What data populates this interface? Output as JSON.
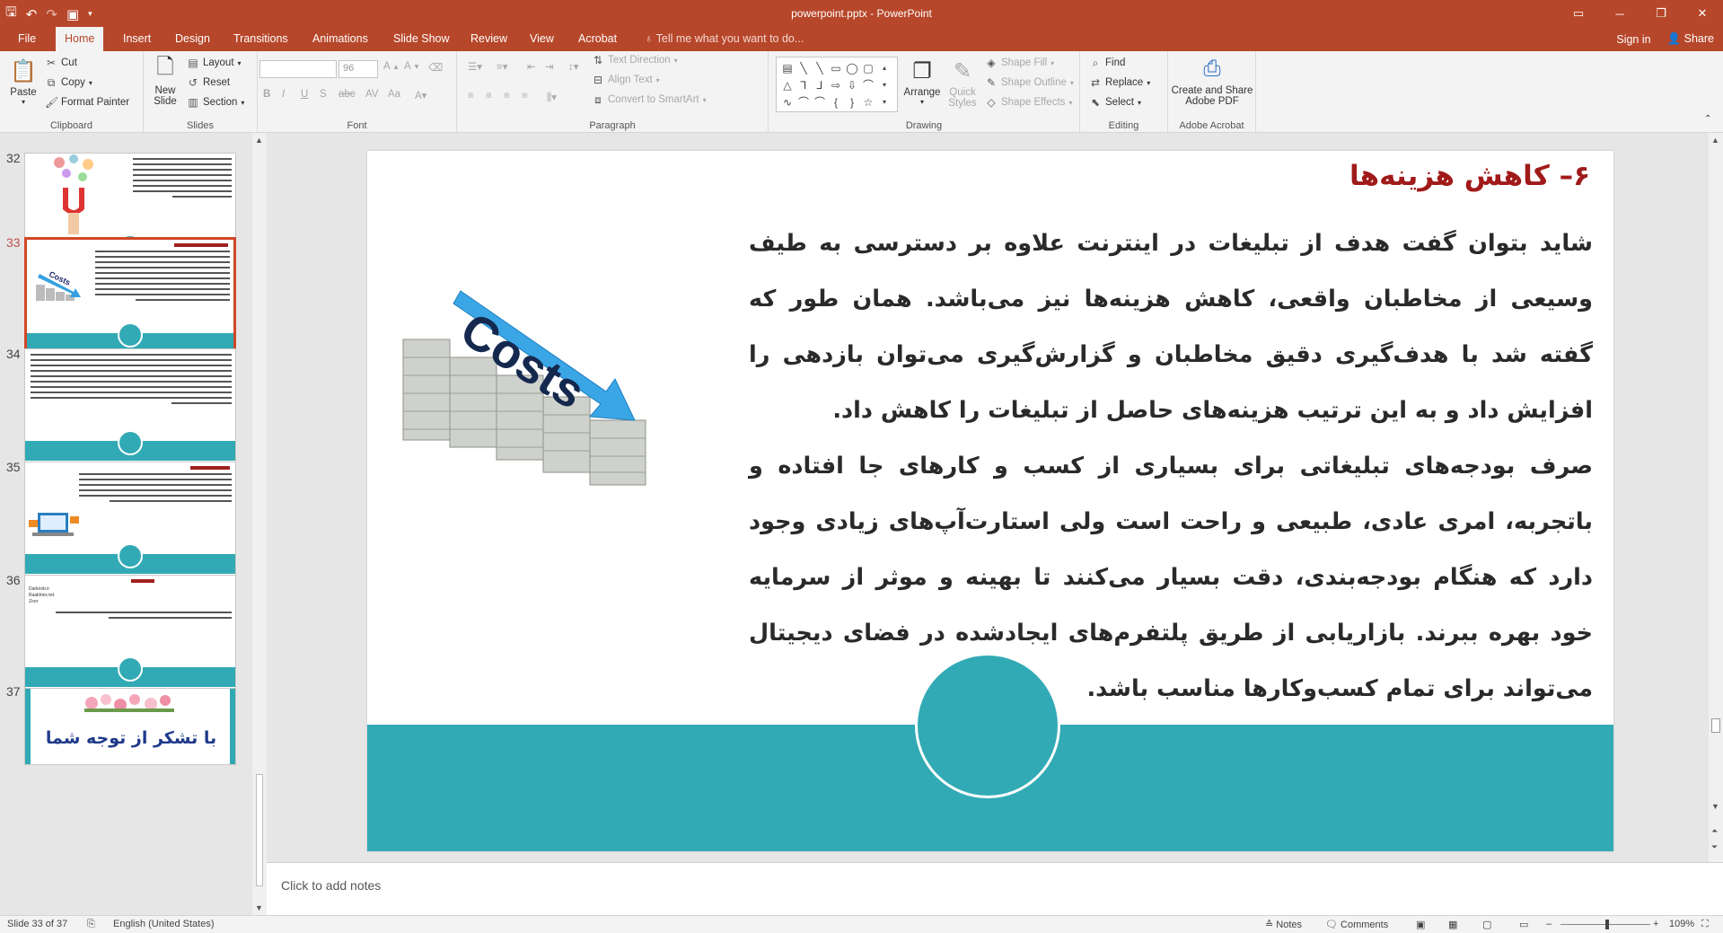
{
  "window": {
    "title": "powerpoint.pptx - PowerPoint",
    "minimize_glyph": "─",
    "restore_glyph": "❐",
    "close_glyph": "✕"
  },
  "quick_access": {
    "save_icon": "save-icon",
    "undo_icon": "undo-icon",
    "redo_icon": "redo-icon",
    "slideshow_icon": "start-from-beginning-icon"
  },
  "tabs": [
    {
      "label": "File"
    },
    {
      "label": "Home",
      "active": true
    },
    {
      "label": "Insert"
    },
    {
      "label": "Design"
    },
    {
      "label": "Transitions"
    },
    {
      "label": "Animations"
    },
    {
      "label": "Slide Show"
    },
    {
      "label": "Review"
    },
    {
      "label": "View"
    },
    {
      "label": "Acrobat"
    }
  ],
  "tell_me": "Tell me what you want to do...",
  "account": {
    "sign_in": "Sign in",
    "share": "Share"
  },
  "ribbon": {
    "clipboard": {
      "label": "Clipboard",
      "paste": "Paste",
      "cut": "Cut",
      "copy": "Copy",
      "format_painter": "Format Painter"
    },
    "slides": {
      "label": "Slides",
      "new_slide_line1": "New",
      "new_slide_line2": "Slide",
      "layout": "Layout",
      "reset": "Reset",
      "section": "Section"
    },
    "font": {
      "label": "Font",
      "size_value": "96"
    },
    "paragraph": {
      "label": "Paragraph",
      "text_direction": "Text Direction",
      "align_text": "Align Text",
      "convert_smartart": "Convert to SmartArt"
    },
    "drawing": {
      "label": "Drawing",
      "arrange": "Arrange",
      "quick_styles_line1": "Quick",
      "quick_styles_line2": "Styles",
      "shape_fill": "Shape Fill",
      "shape_outline": "Shape Outline",
      "shape_effects": "Shape Effects"
    },
    "editing": {
      "label": "Editing",
      "find": "Find",
      "replace": "Replace",
      "select": "Select"
    },
    "acrobat": {
      "label": "Adobe Acrobat",
      "create_line1": "Create and Share",
      "create_line2": "Adobe PDF"
    }
  },
  "thumbnails": [
    {
      "number": "32"
    },
    {
      "number": "33",
      "active": true,
      "image_text": "Costs"
    },
    {
      "number": "34"
    },
    {
      "number": "35"
    },
    {
      "number": "36",
      "refs": [
        "Darkoob.ir",
        "Raakhter.net",
        "Zoor"
      ]
    },
    {
      "number": "37",
      "caption": "با تشکر از توجه شما"
    }
  ],
  "slide": {
    "title": "۶– کاهش هزینه‌ها",
    "image_text": "Costs",
    "paragraph1": "شاید بتوان گفت هدف از تبلیغات در اینترنت علاوه بر دسترسی به طیف وسیعی از مخاطبان واقعی، کاهش هزینه‌ها نیز می‌باشد. همان طور که گفته شد با هدف‌گیری دقیق مخاطبان و گزارش‌گیری می‌توان بازدهی را افزایش داد و به این ترتیب هزینه‌های حاصل از تبلیغات را کاهش داد.",
    "paragraph2": "صرف بودجه‌های تبلیغاتی برای بسیاری از کسب و کارهای جا افتاده و باتجربه، امری عادی، طبیعی و راحت است ولی استارت‌آپ‌های زیادی وجود دارد که هنگام بودجه‌بندی، دقت بسیار می‌کنند تا بهینه و موثر از سرمایه خود بهره ببرند. بازاریابی از طریق پلتفرم‌های ایجادشده در فضای دیجیتال می‌تواند برای تمام کسب‌وکارها مناسب باشد."
  },
  "notes_placeholder": "Click to add notes",
  "status": {
    "slide_info": "Slide 33 of 37",
    "language": "English (United States)",
    "notes": "Notes",
    "comments": "Comments",
    "zoom": "109%"
  },
  "colors": {
    "accent": "#b7472a",
    "teal": "#31aab5",
    "title_red": "#a01a1a"
  }
}
